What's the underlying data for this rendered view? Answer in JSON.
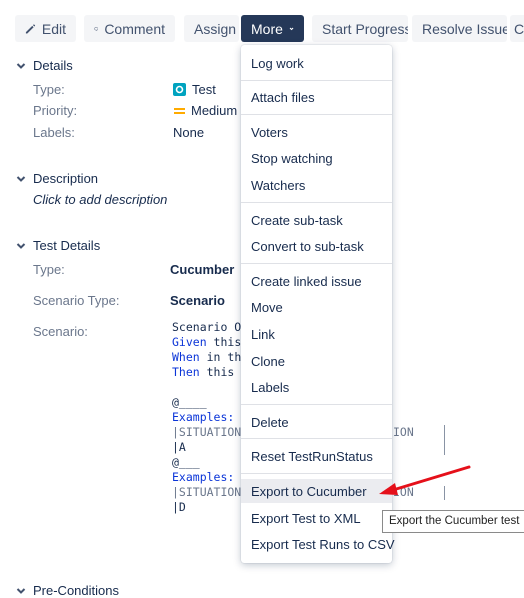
{
  "toolbar": {
    "edit": "Edit",
    "comment": "Comment",
    "assign": "Assign",
    "more": "More",
    "start_progress": "Start Progress",
    "resolve_issue": "Resolve Issue",
    "overflow": "Cl"
  },
  "details": {
    "title": "Details",
    "type_label": "Type:",
    "type_value": "Test",
    "priority_label": "Priority:",
    "priority_value": "Medium",
    "labels_label": "Labels:",
    "labels_value": "None"
  },
  "description": {
    "title": "Description",
    "placeholder": "Click to add description"
  },
  "test_details": {
    "title": "Test Details",
    "type_label": "Type:",
    "type_value": "Cucumber",
    "scenario_type_label": "Scenario Type:",
    "scenario_type_value": "Scenario",
    "scenario_label": "Scenario:",
    "code": {
      "line1": "Scenario O",
      "line2_kw": "Given",
      "line2_rest": " this",
      "line3_kw": "When",
      "line3_rest": " in th",
      "line4_kw": "Then",
      "line4_rest": " this",
      "tag1": "@____",
      "examples1": "Examples:",
      "table1_head": "|SITUATION",
      "table1_row": "|A",
      "tag2": "@___",
      "examples2": "Examples:",
      "table2_head": "|SITUATION",
      "table2_row": "|D",
      "head_tail1": "ION",
      "head_tail2": "ION"
    }
  },
  "pre_conditions": {
    "title": "Pre-Conditions"
  },
  "more_menu": {
    "items": [
      "Log work",
      "Attach files",
      "Voters",
      "Stop watching",
      "Watchers",
      "Create sub-task",
      "Convert to sub-task",
      "Create linked issue",
      "Move",
      "Link",
      "Clone",
      "Labels",
      "Delete",
      "Reset TestRunStatus",
      "Export to Cucumber",
      "Export Test to XML",
      "Export Test Runs to CSV"
    ],
    "highlighted": "Export to Cucumber"
  },
  "tooltip": {
    "text": "Export the Cucumber test"
  },
  "colors": {
    "more_bg": "#253858",
    "code_keyword": "#0b35d8",
    "priority_medium": "#ffab00",
    "test_icon": "#00a3bf",
    "annotation_arrow": "#e5101a"
  }
}
